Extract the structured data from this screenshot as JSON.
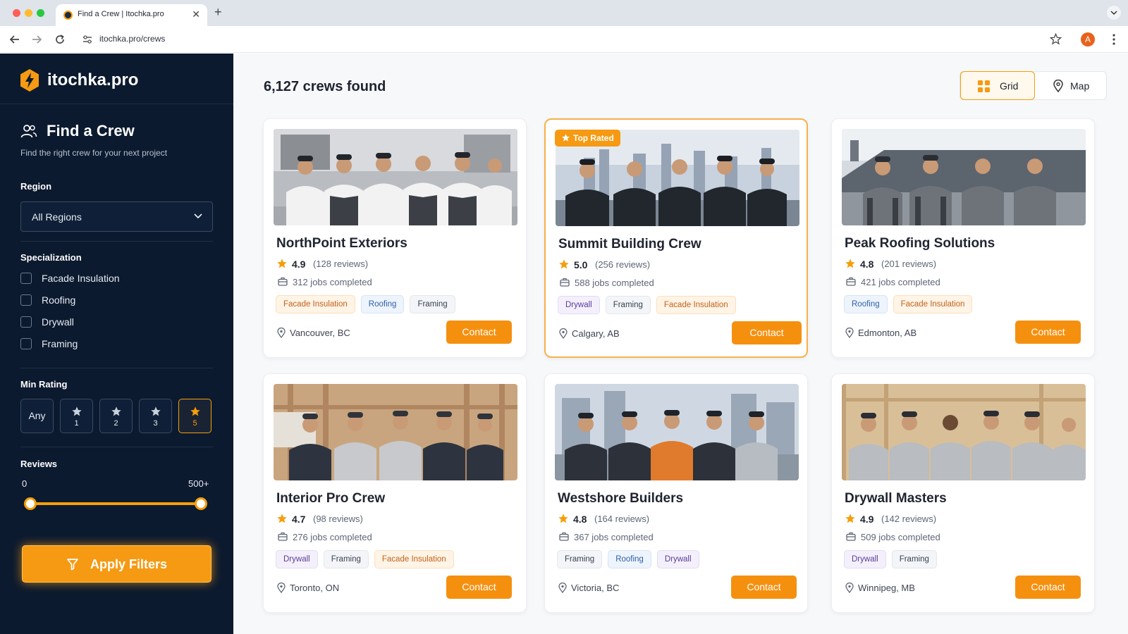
{
  "browser": {
    "tab_title": "Find a Crew | Itochka.pro",
    "url": "itochka.pro/crews",
    "profile_initial": "A"
  },
  "sidebar": {
    "brand": "itochka.pro",
    "title": "Find a Crew",
    "subtitle": "Find the right crew for your next project",
    "region": {
      "label": "Region",
      "value": "All Regions"
    },
    "specialization": {
      "label": "Specialization",
      "options": [
        {
          "label": "Facade Insulation",
          "checked": false
        },
        {
          "label": "Roofing",
          "checked": false
        },
        {
          "label": "Drywall",
          "checked": false
        },
        {
          "label": "Framing",
          "checked": false
        }
      ]
    },
    "min_rating": {
      "label": "Min Rating",
      "options": [
        "Any",
        "1",
        "2",
        "3",
        "5"
      ],
      "selected": "5"
    },
    "reviews": {
      "label": "Reviews",
      "min": "0",
      "max": "500+"
    },
    "apply_label": "Apply Filters"
  },
  "main": {
    "results": "6,127 crews found",
    "view_toggle": {
      "grid": "Grid",
      "map": "Map",
      "active": "Grid"
    },
    "cards": [
      {
        "name": "NorthPoint Exteriors",
        "rating": "4.9",
        "reviews": "(128 reviews)",
        "jobs": "312 jobs completed",
        "tags": [
          "Facade Insulation",
          "Roofing",
          "Framing"
        ],
        "location": "Vancouver, BC",
        "contact": "Contact"
      },
      {
        "name": "Summit Building Crew",
        "rating": "5.0",
        "reviews": "(256 reviews)",
        "jobs": "588 jobs completed",
        "tags": [
          "Drywall",
          "Framing",
          "Facade Insulation"
        ],
        "location": "Calgary, AB",
        "contact": "Contact",
        "badge": "Top Rated"
      },
      {
        "name": "Peak Roofing Solutions",
        "rating": "4.8",
        "reviews": "(201 reviews)",
        "jobs": "421 jobs completed",
        "tags": [
          "Roofing",
          "Facade Insulation"
        ],
        "location": "Edmonton, AB",
        "contact": "Contact"
      },
      {
        "name": "Interior Pro Crew",
        "rating": "4.7",
        "reviews": "(98 reviews)",
        "jobs": "276 jobs completed",
        "tags": [
          "Drywall",
          "Framing",
          "Facade Insulation"
        ],
        "location": "Toronto, ON",
        "contact": "Contact"
      },
      {
        "name": "Westshore Builders",
        "rating": "4.8",
        "reviews": "(164 reviews)",
        "jobs": "367 jobs completed",
        "tags": [
          "Framing",
          "Roofing",
          "Drywall"
        ],
        "location": "Victoria, BC",
        "contact": "Contact"
      },
      {
        "name": "Drywall Masters",
        "rating": "4.9",
        "reviews": "(142 reviews)",
        "jobs": "509 jobs completed",
        "tags": [
          "Drywall",
          "Framing"
        ],
        "location": "Winnipeg, MB",
        "contact": "Contact"
      }
    ]
  },
  "colors": {
    "accent": "#f59a12",
    "sidebar_bg": "#0c1a2f",
    "tag_facade": "#c2611b",
    "tag_roofing": "#2f5fa8",
    "tag_framing": "#374151",
    "tag_drywall": "#5b3d99"
  }
}
